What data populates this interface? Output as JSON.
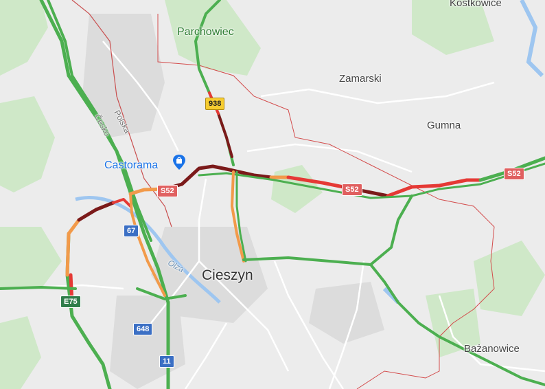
{
  "map": {
    "places": {
      "kostkowice": "Kostkowice",
      "parchowiec": "Parchowiec",
      "zamarski": "Zamarski",
      "gumna": "Gumna",
      "castorama": "Castorama",
      "cieszyn": "Cieszyn",
      "bazanowice": "Bażanowice",
      "olza": "Olza",
      "polska": "Polska",
      "cesko": "Česko"
    },
    "road_shields": {
      "r938": "938",
      "s52_a": "S52",
      "s52_b": "S52",
      "s52_c": "S52",
      "r67": "67",
      "e75": "E75",
      "r648": "648",
      "r11": "11"
    },
    "traffic_colors": {
      "free": "#4caf50",
      "moderate": "#f29a4a",
      "heavy": "#e53935",
      "severe": "#7b1a1a"
    },
    "icons": {
      "castorama_pin": "shopping-bag-icon"
    }
  }
}
